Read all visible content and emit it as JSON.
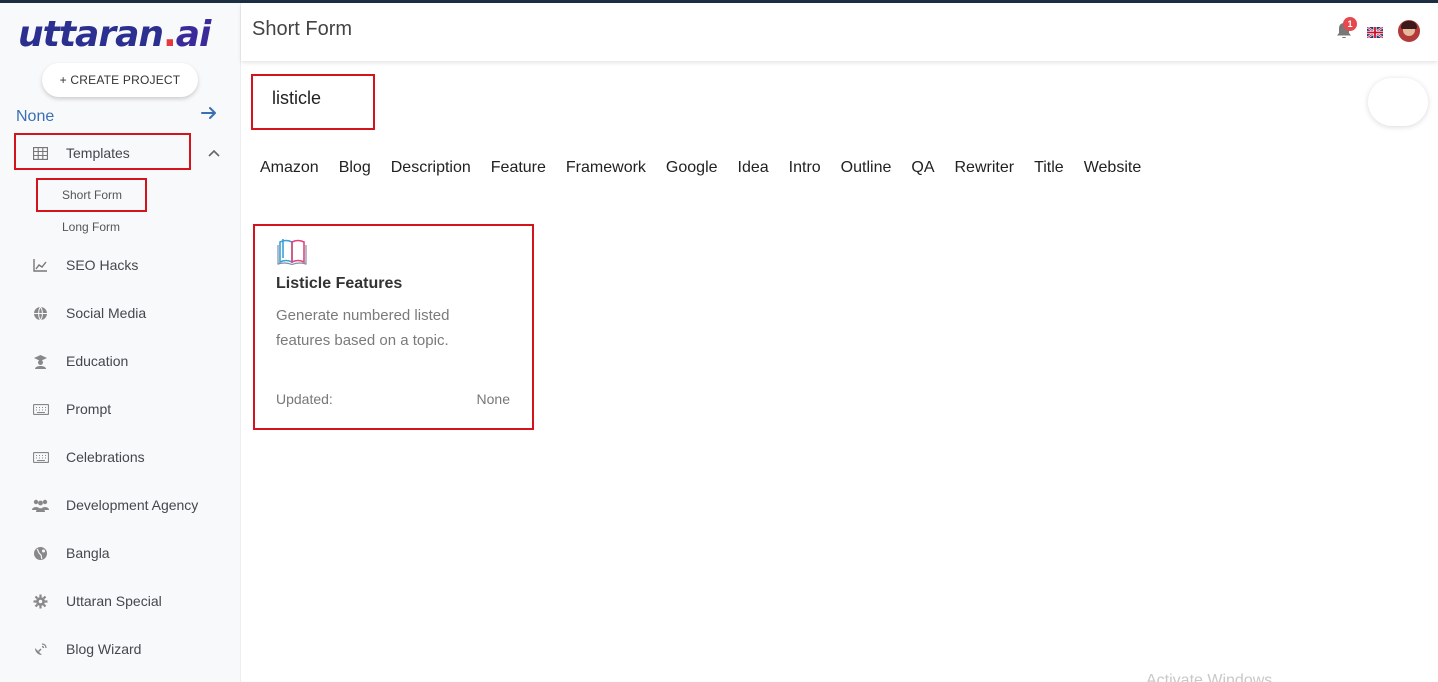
{
  "app": {
    "logo_main": "uttaran",
    "logo_dot": ".",
    "logo_ai": "ai",
    "accent_color": "#3a6fb5",
    "highlight_color": "#d4141c"
  },
  "sidebar": {
    "create_project_label": "+ CREATE PROJECT",
    "project_name": "None",
    "items": [
      {
        "label": "Templates",
        "icon": "grid-icon"
      },
      {
        "label": "SEO Hacks",
        "icon": "chart-line-icon"
      },
      {
        "label": "Social Media",
        "icon": "globe-icon"
      },
      {
        "label": "Education",
        "icon": "graduate-icon"
      },
      {
        "label": "Prompt",
        "icon": "keyboard-icon"
      },
      {
        "label": "Celebrations",
        "icon": "keyboard-icon"
      },
      {
        "label": "Development Agency",
        "icon": "people-icon"
      },
      {
        "label": "Bangla",
        "icon": "globe-alt-icon"
      },
      {
        "label": "Uttaran Special",
        "icon": "gear-icon"
      },
      {
        "label": "Blog Wizard",
        "icon": "satellite-icon"
      }
    ],
    "subitems": [
      {
        "label": "Short Form"
      },
      {
        "label": "Long Form"
      }
    ]
  },
  "header": {
    "title": "Short Form",
    "notification_count": "1"
  },
  "search": {
    "value": "listicle"
  },
  "tabs": [
    "Amazon",
    "Blog",
    "Description",
    "Feature",
    "Framework",
    "Google",
    "Idea",
    "Intro",
    "Outline",
    "QA",
    "Rewriter",
    "Title",
    "Website"
  ],
  "card": {
    "title": "Listicle Features",
    "description": "Generate numbered listed features based on a topic.",
    "updated_label": "Updated:",
    "updated_value": "None"
  },
  "watermark": "Activate Windows"
}
